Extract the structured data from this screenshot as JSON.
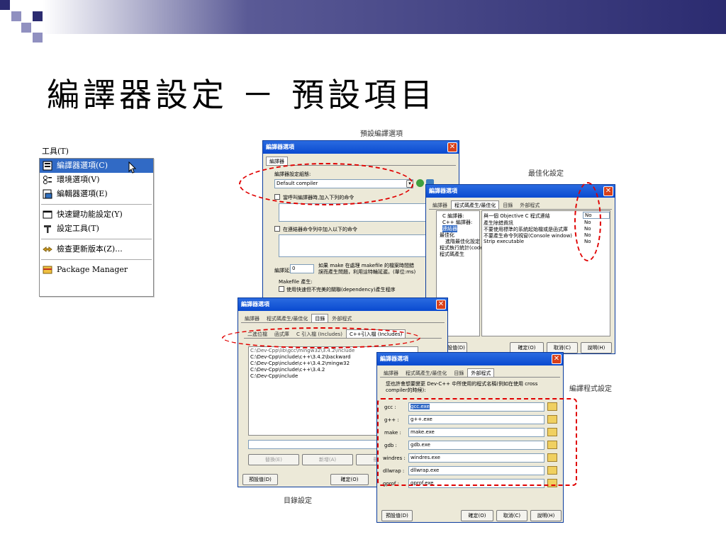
{
  "slide": {
    "title": "編譯器設定 － 預設項目",
    "captions": {
      "default_options": "預設編譯選項",
      "optimization": "最佳化設定",
      "program_settings": "編譯程式設定",
      "directory_settings": "目錄設定"
    }
  },
  "tools_menu": {
    "title": "工具(T)",
    "items": [
      {
        "label": "編譯器選項(C)",
        "icon": "compiler-options-icon"
      },
      {
        "label": "環境選項(V)",
        "icon": "environment-options-icon"
      },
      {
        "label": "編輯器選項(E)",
        "icon": "editor-options-icon"
      },
      {
        "label": "快速鍵功能設定(Y)",
        "icon": "shortcut-icon"
      },
      {
        "label": "設定工具(T)",
        "icon": "tool-config-icon"
      },
      {
        "label": "檢查更新版本(Z)...",
        "icon": "update-check-icon"
      },
      {
        "label": "Package Manager",
        "icon": "package-manager-icon"
      }
    ]
  },
  "dialog_main": {
    "title": "編譯器選項",
    "tab_active": "編譯器",
    "compiler_set_label": "編譯器設定組態:",
    "compiler_set_value": "Default compiler",
    "check_add_compiler": "當呼叫編譯器時,加入下列的命令",
    "check_add_linker": "在連結器命令列中加入以下的命令",
    "delay_label": "編譯延遲",
    "delay_value": "0",
    "delay_desc": "如果 make 在處理 makefile 的檔案時間錯誤而產生問題，利用這特輪延遲。(單位:ms)",
    "makefile_label": "Makefile 產生:",
    "makefile_option": "使用快速但不完美的關聯(dependency)產生程序"
  },
  "dialog_opt": {
    "title": "編譯器選項",
    "tabs": [
      "編譯器",
      "程式碼產生/最佳化",
      "目錄",
      "外部程式"
    ],
    "tree": [
      "C 編譯器:",
      "C++ 編譯器:",
      "連結器",
      "最佳化",
      "進階最佳化設定",
      "程式執行統計(code)",
      "程式碼產生"
    ],
    "options": [
      {
        "name": "與一個 Objective C 程式連結",
        "value": "No"
      },
      {
        "name": "產生除錯資訊",
        "value": "No"
      },
      {
        "name": "不要使用標準的系統起始檔或是函式庫",
        "value": "No"
      },
      {
        "name": "不要產生命令列視窗(Console window)",
        "value": "No"
      },
      {
        "name": "Strip executable",
        "value": "No"
      }
    ],
    "default_button": "預設值(D)",
    "ok_button": "確定(O)",
    "cancel_button": "取消(C)",
    "help_button": "說明(H)"
  },
  "dialog_dir": {
    "title": "編譯器選項",
    "tabs": [
      "編譯器",
      "程式碼產生/最佳化",
      "目錄",
      "外部程式"
    ],
    "subtabs": [
      "二進位檔",
      "函式庫",
      "C 引入檔 (Includes)",
      "C++引入檔 (Includes)"
    ],
    "paths": [
      "C:\\Dev-Cpp\\include\\c++\\3.4.2\\backward",
      "C:\\Dev-Cpp\\include\\c++\\3.4.2\\mingw32",
      "C:\\Dev-Cpp\\include\\c++\\3.4.2",
      "C:\\Dev-Cpp\\include"
    ],
    "first_path": "C:\\Dev-Cpp\\lib\\gcc\\mingw32\\3.4.2\\include",
    "replace_button": "替換(E)",
    "add_button": "新增(A)",
    "delete_button": "刪除(L)",
    "default_button": "預設值(D)",
    "ok_button": "確定(O)"
  },
  "dialog_prog": {
    "title": "編譯器選項",
    "tabs": [
      "編譯器",
      "程式碼產生/最佳化",
      "目錄",
      "外部程式"
    ],
    "desc": "您也許會想要變更 Dev-C++ 中所使用的程式名稱(例如在使用 cross compiler的時候):",
    "programs": [
      {
        "name": "gcc :",
        "value": "gcc.exe"
      },
      {
        "name": "g++ :",
        "value": "g++.exe"
      },
      {
        "name": "make :",
        "value": "make.exe"
      },
      {
        "name": "gdb :",
        "value": "gdb.exe"
      },
      {
        "name": "windres :",
        "value": "windres.exe"
      },
      {
        "name": "dllwrap :",
        "value": "dllwrap.exe"
      },
      {
        "name": "gprof :",
        "value": "gprof.exe"
      }
    ],
    "default_button": "預設值(D)",
    "ok_button": "確定(O)",
    "cancel_button": "取消(C)",
    "help_button": "說明(H)"
  }
}
